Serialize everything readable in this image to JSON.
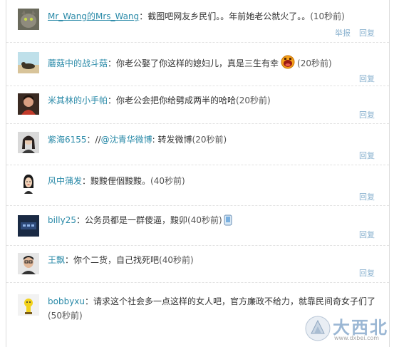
{
  "comments": [
    {
      "user": "Mr_Wang的Mrs_Wang",
      "sep": "：",
      "text": "截图吧网友乡民们。。年前她老公就火了。。",
      "time": "(10秒前)",
      "actions": [
        "举报",
        "回复"
      ]
    },
    {
      "user": "蘑菇中的战斗菇",
      "sep": "：",
      "text": "你老公娶了你这样的媳妇儿，真是三生有幸",
      "time": "(20秒前)",
      "actions": [
        "回复"
      ]
    },
    {
      "user": "米其林的小手帕",
      "sep": "：",
      "text": "你老公会把你给劈成两半的哈哈",
      "time": "(20秒前)",
      "actions": [
        "回复"
      ]
    },
    {
      "user": "紫海6155",
      "sep": "：//",
      "mention": "@沈青华微博",
      "text": ": 转发微博",
      "time": "(20秒前)",
      "actions": [
        "回复"
      ]
    },
    {
      "user": "风中蒲发",
      "sep": "：",
      "text": "黢黢俚個黢黢。",
      "time": "(40秒前)",
      "actions": [
        "回复"
      ]
    },
    {
      "user": "billy25",
      "sep": "：",
      "text": "公务员都是一群傻逼，黢卯",
      "time": "(40秒前)",
      "actions": [
        "回复"
      ]
    },
    {
      "user": "王飘",
      "sep": "：",
      "text": "你个二货，自己找死吧",
      "time": "(40秒前)",
      "actions": [
        "回复"
      ]
    },
    {
      "user": "bobbyxu",
      "sep": "：",
      "text": "请求这个社会多一点这样的女人吧，官方廉政不给力，就靠民间奇女子们了",
      "time": "(50秒前)",
      "actions": [
        "回复"
      ]
    }
  ],
  "watermark": {
    "text": "大西北",
    "url": "www.dxbei.com"
  },
  "colors": {
    "link": "#2a8aa8",
    "action": "#8ab2cf",
    "text": "#333333",
    "border": "#dcdcdc"
  }
}
